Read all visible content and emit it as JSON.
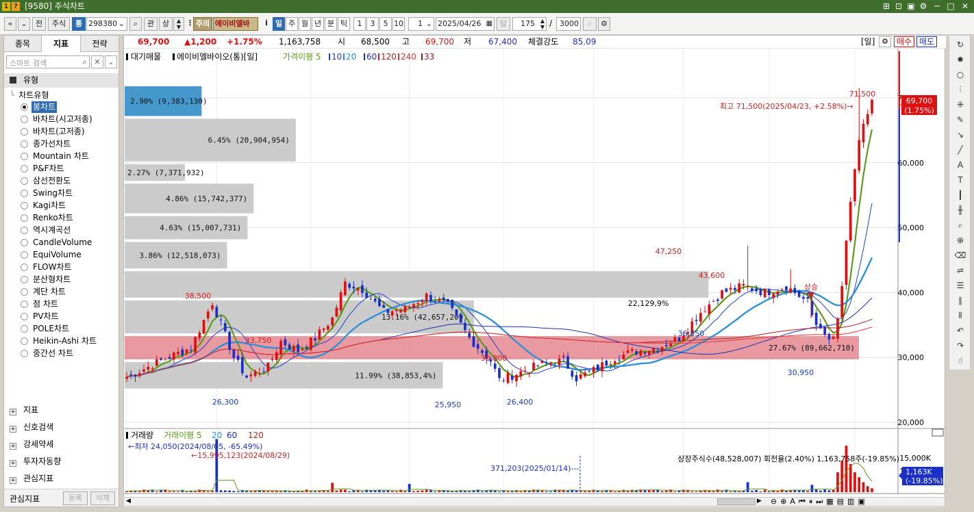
{
  "window": {
    "title": "[9580] 주식차트"
  },
  "toolbar": {
    "nav_prev": "«",
    "nav_down": "»",
    "btn_jeon": "전",
    "market": "주식",
    "btn_tong": "통",
    "code": "298380",
    "btn_gwan": "관",
    "btn_sang": "상",
    "warn_tag": "주의",
    "stock_name": "에이비엘바",
    "i_label": "i",
    "periods": [
      "일",
      "주",
      "월",
      "년",
      "분",
      "틱"
    ],
    "period_selected": "일",
    "minutes": [
      "1",
      "3",
      "5",
      "10"
    ],
    "interval": "1",
    "date": "2025/04/26",
    "btn_dang": "당",
    "count": "175",
    "slash": "/",
    "max": "3000"
  },
  "sidebar": {
    "tabs": [
      "종목",
      "지표",
      "전략"
    ],
    "active_tab": "지표",
    "search_placeholder": "스마트 검색",
    "group_title": "유형",
    "tree_root": "차트유형",
    "items": [
      "봉차트",
      "바차트(시고저종)",
      "바차트(고저종)",
      "종가선차트",
      "Mountain 차트",
      "P&F차트",
      "삼선전환도",
      "Swing차트",
      "Kagi차트",
      "Renko차트",
      "역시계곡선",
      "CandleVolume",
      "EquiVolume",
      "FLOW차트",
      "분산형차트",
      "계단 차트",
      "점 차트",
      "PV차트",
      "POLE차트",
      "Heikin-Ashi 차트",
      "중간선 차트"
    ],
    "selected_item": "봉차트",
    "sections": [
      "지표",
      "신호검색",
      "강세약세",
      "투자자동향",
      "관심지표"
    ],
    "footer_label": "관심지표",
    "footer_add": "등록",
    "footer_delete": "삭제"
  },
  "quote": {
    "price": "69,700",
    "change": "▲1,200",
    "rate": "+1.75%",
    "volume": "1,163,758",
    "open_label": "시",
    "open": "68,500",
    "high_label": "고",
    "high": "69,700",
    "low_label": "저",
    "low": "67,400",
    "strength_label": "체결강도",
    "strength": "85.09",
    "period_tag": "[일]",
    "buy": "매수",
    "sell": "매도"
  },
  "legend": {
    "title": "대기매물",
    "name": "에이비엘바이오(통)[일]",
    "ma_label": "가격이평",
    "ma_periods": [
      "5",
      "10",
      "20",
      "60",
      "120",
      "240",
      "33"
    ],
    "ma_colors": [
      "#5b9c1a",
      "#1f3fcf",
      "#2f8fd8",
      "#1f2fb0",
      "#b02020",
      "#e03030",
      "#8a1a1a"
    ]
  },
  "vol_legend": {
    "title": "거래량",
    "ma_label": "거래이평",
    "periods": [
      "5",
      "20",
      "60",
      "120"
    ]
  },
  "annotations": {
    "high_note": "최고 71,500(2025/04/23, +2.58%)→",
    "low_note": "←최저 24,050(2024/08/05, -65.49%)",
    "peak_vol": "←15,995,123(2024/08/29)",
    "mark_vol": "371,203(2025/01/14)---",
    "shares": "상장주식수(48,528,007) 회전율(2.40%) 1,163,758주(-19.85%)",
    "signal": "상승"
  },
  "price_labels": [
    {
      "text": "38,500",
      "color": "#d02020"
    },
    {
      "text": "33,750",
      "color": "#d02020"
    },
    {
      "text": "26,300",
      "color": "#1a3fc0"
    },
    {
      "text": "25,950",
      "color": "#1a3fc0"
    },
    {
      "text": "30,800",
      "color": "#d02020"
    },
    {
      "text": "26,400",
      "color": "#1a3fc0"
    },
    {
      "text": "47,250",
      "color": "#d02020"
    },
    {
      "text": "43,600",
      "color": "#d02020"
    },
    {
      "text": "36,850",
      "color": "#1a3fc0"
    },
    {
      "text": "30,950",
      "color": "#1a3fc0"
    },
    {
      "text": "71,500",
      "color": "#d02020"
    },
    {
      "text": "22,1",
      "color": "#000"
    },
    {
      "text": "29,9%",
      "color": "#000"
    }
  ],
  "volume_profile": [
    {
      "label": "2.90% (9,383,130)",
      "pct": 2.9,
      "hl": "blue"
    },
    {
      "label": "6.45% (20,904,954)",
      "pct": 6.45,
      "hl": "none"
    },
    {
      "label": "2.27% (7,371,932)",
      "pct": 2.27,
      "hl": "none"
    },
    {
      "label": "4.86% (15,742,377)",
      "pct": 4.86,
      "hl": "none"
    },
    {
      "label": "4.63% (15,007,731)",
      "pct": 4.63,
      "hl": "none"
    },
    {
      "label": "3.86% (12,518,073)",
      "pct": 3.86,
      "hl": "none"
    },
    {
      "label": "22.xx",
      "pct": 22.0,
      "hl": "none"
    },
    {
      "label": "13.16% (42,657,209)",
      "pct": 13.16,
      "hl": "none"
    },
    {
      "label": "27.67% (89,662,710)",
      "pct": 27.67,
      "hl": "red"
    },
    {
      "label": "11.99% (38,853,4%)",
      "pct": 11.99,
      "hl": "none"
    }
  ],
  "y_axis": [
    "70,000",
    "60,000",
    "50,000",
    "40,000",
    "30,000",
    "20,000"
  ],
  "vol_axis": [
    "15,000K",
    "10,000K"
  ],
  "x_axis": [
    "2024/08",
    "09",
    "10",
    "11",
    "12",
    "2025/01",
    "02",
    "03",
    "04",
    "04/30"
  ],
  "current": {
    "price": "69,700",
    "rate": "(1.75%)",
    "vol": "1,163K",
    "vol_rate": "(-19.85%)"
  },
  "colors": {
    "up": "#e01010",
    "down": "#1a30c8",
    "accent": "#2d6cb5",
    "title_bar": "#3f6e2c"
  }
}
